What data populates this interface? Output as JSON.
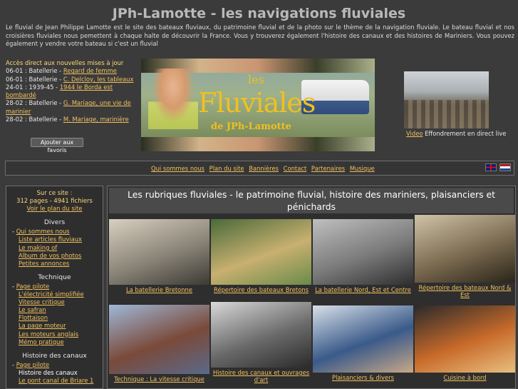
{
  "header": {
    "title": "JPh-Lamotte - les navigations fluviales"
  },
  "intro": "Le fluvial de Jean Philippe Lamotte est le site des bateaux fluviaux, du patrimoine fluvial et de la photo sur le thème de la navigation fluviale. Le bateau fluvial et nos croisières fluviales nous pemettent à chaque halte de découvrir la France. Vous y trouverez également l'histoire des canaux et des histoires de Mariniers. Vous pouvez également y vendre votre bateau si c'est un fluvial",
  "updates": {
    "heading": "Accès direct aux nouvelles mises à jour",
    "items": [
      {
        "prefix": "06-01 : Batellerie - ",
        "link": "Regard de femme"
      },
      {
        "prefix": "06-01 : Batellerie - ",
        "link": "C. Delcloy, les tableaux"
      },
      {
        "prefix": "24-01 : 1939-45 - ",
        "link": "1944 le Borda est bombardé"
      },
      {
        "prefix": "28-02 : Batellerie - ",
        "link": "G. Mariage, une vie de marinier"
      },
      {
        "prefix": "28-02 : Batellerie - ",
        "link": "M. Mariage, marinière"
      }
    ],
    "favorites_button": "Ajouter aux favoris"
  },
  "banner": {
    "line1": "les",
    "line2": "Fluviales",
    "line3": "de JPh-Lamotte"
  },
  "video": {
    "link": "Video",
    "text": " Effondrement en direct live"
  },
  "nav": {
    "items": [
      "Qui sommes nous",
      "Plan du site",
      "Bannières",
      "Contact",
      "Partenaires",
      "Musique"
    ]
  },
  "sidebar": {
    "site_heading": "Sur ce site :",
    "site_stats": "312 pages - 4941 fichiers",
    "site_map_link": "Voir le plan du site",
    "sections": [
      {
        "title": "Divers",
        "items": [
          {
            "text": "Qui sommes nous",
            "level": 1,
            "link": true
          },
          {
            "text": "Liste articles fluviaux",
            "level": 2,
            "link": true
          },
          {
            "text": "Le making of",
            "level": 2,
            "link": true
          },
          {
            "text": "Album de vos photos",
            "level": 2,
            "link": true
          },
          {
            "text": "Petites annonces",
            "level": 2,
            "link": true
          }
        ]
      },
      {
        "title": "Technique",
        "items": [
          {
            "text": "Page pilote",
            "level": 1,
            "link": true
          },
          {
            "text": "L'électricité simplifiée",
            "level": 2,
            "link": true
          },
          {
            "text": "Vitesse critique",
            "level": 2,
            "link": true
          },
          {
            "text": "Le safran",
            "level": 2,
            "link": true
          },
          {
            "text": "Flottaison",
            "level": 2,
            "link": true
          },
          {
            "text": "La page moteur",
            "level": 2,
            "link": true
          },
          {
            "text": "Les moteurs anglais",
            "level": 2,
            "link": true
          },
          {
            "text": "Mémo pratique",
            "level": 2,
            "link": true
          }
        ]
      },
      {
        "title": "Histoire des canaux",
        "items": [
          {
            "text": "Page pilote",
            "level": 1,
            "link": true
          },
          {
            "text": "Histoire des canaux",
            "level": 2,
            "link": false
          },
          {
            "text": "Le pont canal de Briare 1",
            "level": 2,
            "link": true
          }
        ]
      }
    ]
  },
  "main": {
    "title": "Les rubriques fluviales   -   le patrimoine fluvial, histoire des mariniers, plaisanciers et pénichards",
    "tiles": [
      {
        "caption": "La batellerie Bretonne",
        "img_colors": [
          "#d8d0c0",
          "#8a8478",
          "#3c3a34"
        ]
      },
      {
        "caption": "Répertoire des bateaux Bretons",
        "img_colors": [
          "#4a6a3a",
          "#c8b070",
          "#6a8a4a"
        ]
      },
      {
        "caption": "La batellerie Nord, Est et Centre",
        "img_colors": [
          "#bfbfbf",
          "#7a7a7a",
          "#2e2e2e"
        ]
      },
      {
        "caption": "Répertoire des bateaux Nord & Est",
        "img_colors": [
          "#cfc3a8",
          "#7a6a50",
          "#2a2418"
        ]
      },
      {
        "caption": "Technique : La vitesse critique",
        "img_colors": [
          "#9fb8d8",
          "#7a4a3a",
          "#5a6a8a"
        ]
      },
      {
        "caption": "Histoire des canaux et ouvrages d'art",
        "img_colors": [
          "#d8d8d8",
          "#6a6a6a",
          "#2a2a2a"
        ]
      },
      {
        "caption": "Plaisanciers & divers",
        "img_colors": [
          "#d8e0e8",
          "#3a5a8a",
          "#c8a888"
        ]
      },
      {
        "caption": "Cuisine à bord",
        "img_colors": [
          "#2a2a2a",
          "#c86a2a",
          "#e8c080"
        ]
      }
    ]
  }
}
